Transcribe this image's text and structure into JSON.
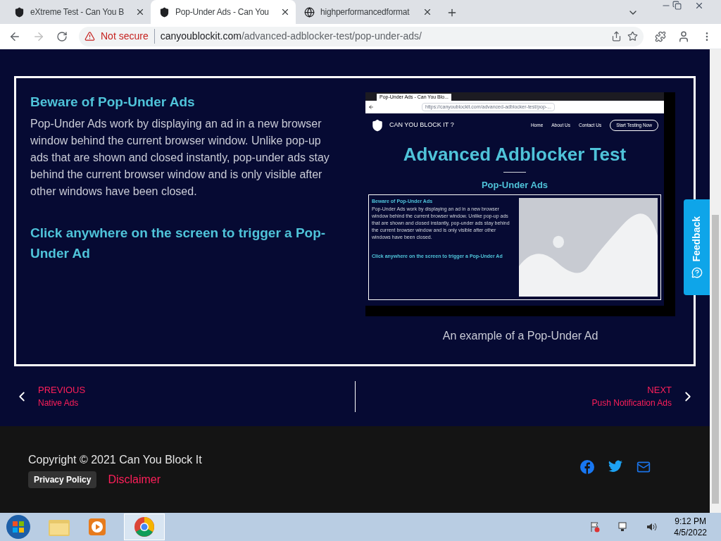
{
  "browser": {
    "tabs": [
      {
        "title": "eXtreme Test - Can You B",
        "selected": false,
        "kind": "site"
      },
      {
        "title": "Pop-Under Ads - Can You",
        "selected": true,
        "kind": "site"
      },
      {
        "title": "highperformancedformat",
        "selected": false,
        "kind": "web"
      }
    ],
    "security": "Not secure",
    "url_host": "canyoublockit.com",
    "url_path": "/advanced-adblocker-test/pop-under-ads/"
  },
  "article": {
    "heading": "Beware of Pop-Under Ads",
    "paragraph": "Pop-Under Ads work by displaying an ad in a new browser window behind the current browser window. Unlike pop-up ads that are shown and closed instantly, pop-under ads stay behind the current browser window and is only visible after other windows have been closed.",
    "cta": "Click anywhere on the screen to trigger a Pop-Under Ad"
  },
  "example": {
    "tab": "Pop-Under Ads - Can You Blo...",
    "url": "https://canyoublockit.com/advanced-adblocker-test/pop-...",
    "brand": "CAN YOU BLOCK IT ?",
    "nav": [
      "Home",
      "About Us",
      "Contact Us"
    ],
    "button": "Start Testing Now",
    "title": "Advanced Adblocker Test",
    "subtitle": "Pop-Under Ads",
    "heading": "Beware of Pop-Under Ads",
    "paragraph": "Pop-Under Ads work by displaying an ad in a new browser window behind the current browser window. Unlike pop-up ads that are shown and closed instantly, pop-under ads stay behind the current browser window and is only visible after other windows have been closed.",
    "cta": "Click anywhere on the screen to trigger a Pop-Under Ad",
    "caption": "An example of a Pop-Under Ad"
  },
  "feedback": "Feedback",
  "post_nav": {
    "previous": {
      "label": "PREVIOUS",
      "title": "Native Ads"
    },
    "next": {
      "label": "NEXT",
      "title": "Push Notification Ads"
    }
  },
  "footer": {
    "copyright": "Copyright © 2021 Can You Block It",
    "privacy": "Privacy Policy",
    "disclaimer": "Disclaimer"
  },
  "taskbar": {
    "time": "9:12 PM",
    "date": "4/5/2022"
  }
}
